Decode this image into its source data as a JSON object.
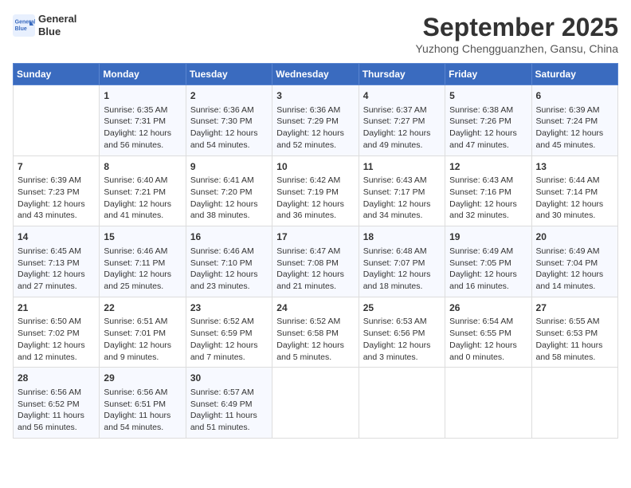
{
  "header": {
    "logo_line1": "General",
    "logo_line2": "Blue",
    "month": "September 2025",
    "location": "Yuzhong Chengguanzhen, Gansu, China"
  },
  "days_of_week": [
    "Sunday",
    "Monday",
    "Tuesday",
    "Wednesday",
    "Thursday",
    "Friday",
    "Saturday"
  ],
  "weeks": [
    [
      {
        "day": "",
        "content": ""
      },
      {
        "day": "1",
        "content": "Sunrise: 6:35 AM\nSunset: 7:31 PM\nDaylight: 12 hours and 56 minutes."
      },
      {
        "day": "2",
        "content": "Sunrise: 6:36 AM\nSunset: 7:30 PM\nDaylight: 12 hours and 54 minutes."
      },
      {
        "day": "3",
        "content": "Sunrise: 6:36 AM\nSunset: 7:29 PM\nDaylight: 12 hours and 52 minutes."
      },
      {
        "day": "4",
        "content": "Sunrise: 6:37 AM\nSunset: 7:27 PM\nDaylight: 12 hours and 49 minutes."
      },
      {
        "day": "5",
        "content": "Sunrise: 6:38 AM\nSunset: 7:26 PM\nDaylight: 12 hours and 47 minutes."
      },
      {
        "day": "6",
        "content": "Sunrise: 6:39 AM\nSunset: 7:24 PM\nDaylight: 12 hours and 45 minutes."
      }
    ],
    [
      {
        "day": "7",
        "content": "Sunrise: 6:39 AM\nSunset: 7:23 PM\nDaylight: 12 hours and 43 minutes."
      },
      {
        "day": "8",
        "content": "Sunrise: 6:40 AM\nSunset: 7:21 PM\nDaylight: 12 hours and 41 minutes."
      },
      {
        "day": "9",
        "content": "Sunrise: 6:41 AM\nSunset: 7:20 PM\nDaylight: 12 hours and 38 minutes."
      },
      {
        "day": "10",
        "content": "Sunrise: 6:42 AM\nSunset: 7:19 PM\nDaylight: 12 hours and 36 minutes."
      },
      {
        "day": "11",
        "content": "Sunrise: 6:43 AM\nSunset: 7:17 PM\nDaylight: 12 hours and 34 minutes."
      },
      {
        "day": "12",
        "content": "Sunrise: 6:43 AM\nSunset: 7:16 PM\nDaylight: 12 hours and 32 minutes."
      },
      {
        "day": "13",
        "content": "Sunrise: 6:44 AM\nSunset: 7:14 PM\nDaylight: 12 hours and 30 minutes."
      }
    ],
    [
      {
        "day": "14",
        "content": "Sunrise: 6:45 AM\nSunset: 7:13 PM\nDaylight: 12 hours and 27 minutes."
      },
      {
        "day": "15",
        "content": "Sunrise: 6:46 AM\nSunset: 7:11 PM\nDaylight: 12 hours and 25 minutes."
      },
      {
        "day": "16",
        "content": "Sunrise: 6:46 AM\nSunset: 7:10 PM\nDaylight: 12 hours and 23 minutes."
      },
      {
        "day": "17",
        "content": "Sunrise: 6:47 AM\nSunset: 7:08 PM\nDaylight: 12 hours and 21 minutes."
      },
      {
        "day": "18",
        "content": "Sunrise: 6:48 AM\nSunset: 7:07 PM\nDaylight: 12 hours and 18 minutes."
      },
      {
        "day": "19",
        "content": "Sunrise: 6:49 AM\nSunset: 7:05 PM\nDaylight: 12 hours and 16 minutes."
      },
      {
        "day": "20",
        "content": "Sunrise: 6:49 AM\nSunset: 7:04 PM\nDaylight: 12 hours and 14 minutes."
      }
    ],
    [
      {
        "day": "21",
        "content": "Sunrise: 6:50 AM\nSunset: 7:02 PM\nDaylight: 12 hours and 12 minutes."
      },
      {
        "day": "22",
        "content": "Sunrise: 6:51 AM\nSunset: 7:01 PM\nDaylight: 12 hours and 9 minutes."
      },
      {
        "day": "23",
        "content": "Sunrise: 6:52 AM\nSunset: 6:59 PM\nDaylight: 12 hours and 7 minutes."
      },
      {
        "day": "24",
        "content": "Sunrise: 6:52 AM\nSunset: 6:58 PM\nDaylight: 12 hours and 5 minutes."
      },
      {
        "day": "25",
        "content": "Sunrise: 6:53 AM\nSunset: 6:56 PM\nDaylight: 12 hours and 3 minutes."
      },
      {
        "day": "26",
        "content": "Sunrise: 6:54 AM\nSunset: 6:55 PM\nDaylight: 12 hours and 0 minutes."
      },
      {
        "day": "27",
        "content": "Sunrise: 6:55 AM\nSunset: 6:53 PM\nDaylight: 11 hours and 58 minutes."
      }
    ],
    [
      {
        "day": "28",
        "content": "Sunrise: 6:56 AM\nSunset: 6:52 PM\nDaylight: 11 hours and 56 minutes."
      },
      {
        "day": "29",
        "content": "Sunrise: 6:56 AM\nSunset: 6:51 PM\nDaylight: 11 hours and 54 minutes."
      },
      {
        "day": "30",
        "content": "Sunrise: 6:57 AM\nSunset: 6:49 PM\nDaylight: 11 hours and 51 minutes."
      },
      {
        "day": "",
        "content": ""
      },
      {
        "day": "",
        "content": ""
      },
      {
        "day": "",
        "content": ""
      },
      {
        "day": "",
        "content": ""
      }
    ]
  ]
}
